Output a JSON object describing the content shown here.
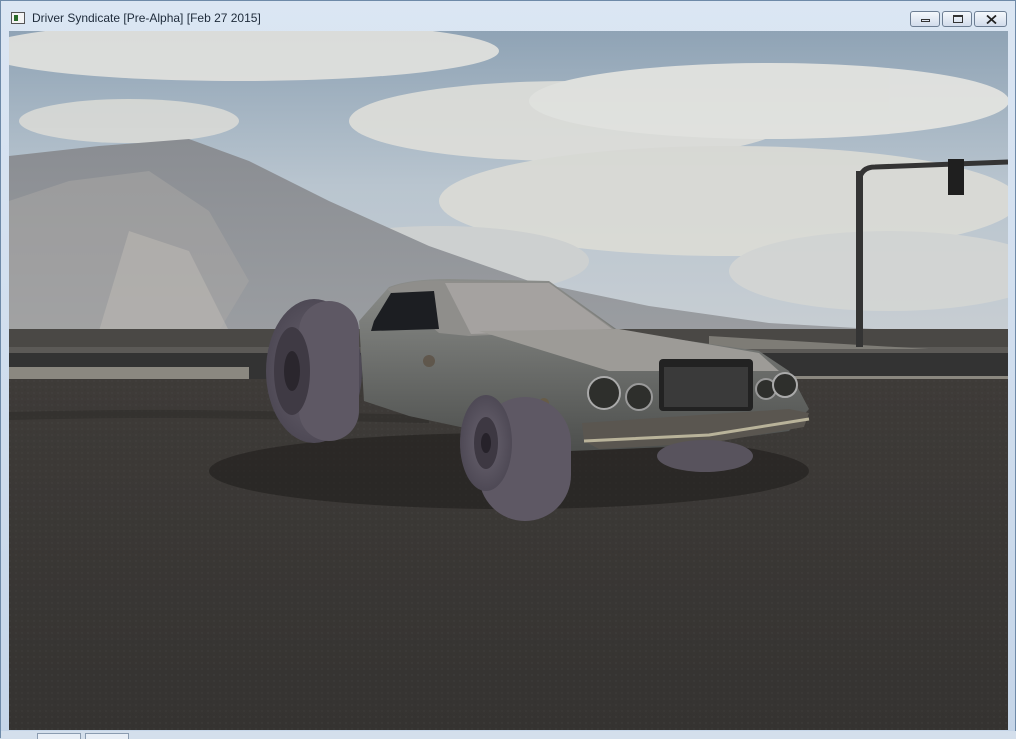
{
  "window": {
    "title": "Driver Syndicate [Pre-Alpha] [Feb 27 2015]",
    "app_icon": "window-app-icon",
    "controls": [
      "minimize-icon",
      "restore-icon",
      "close-icon"
    ]
  },
  "scene": {
    "sky_color": "#aebccb",
    "road_color": "#3a3835",
    "car_body_color": "#6a6d6c",
    "wheel_color": "#5b5560"
  }
}
